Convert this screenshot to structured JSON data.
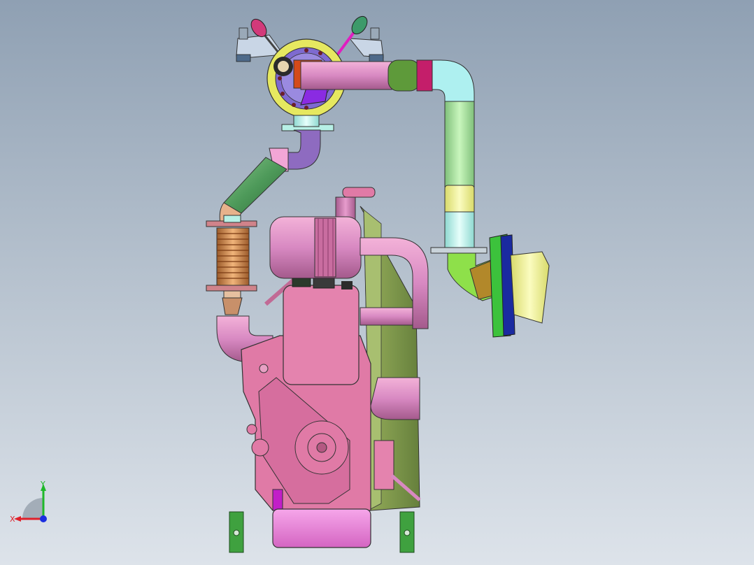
{
  "viewport": {
    "background_top": "#8fa0b3",
    "background_bottom": "#dde3ea"
  },
  "model": {
    "colors": {
      "engine_block": "#e07aa6",
      "engine_dark": "#b45882",
      "oil_pan": "#ee86d6",
      "frame_olive": "#7d9a4e",
      "pipe_pink": "#d889c2",
      "pipe_green": "#6aa870",
      "pipe_light_green": "#b5f0a8",
      "pipe_cyan": "#bff5ee",
      "elbow_yellow": "#e6e89a",
      "flange_yellow": "#e2e25a",
      "muffler_yellow": "#f0f29a",
      "bellows_copper": "#d89a5a",
      "elbow_purple": "#9268c0",
      "band_magenta": "#c41e6a",
      "mount_green": "#3fa13f"
    }
  },
  "triad": {
    "x_label": "X",
    "y_label": "Y",
    "x_color": "#e0202a",
    "y_color": "#1fb82a",
    "z_color": "#1a2de0"
  }
}
